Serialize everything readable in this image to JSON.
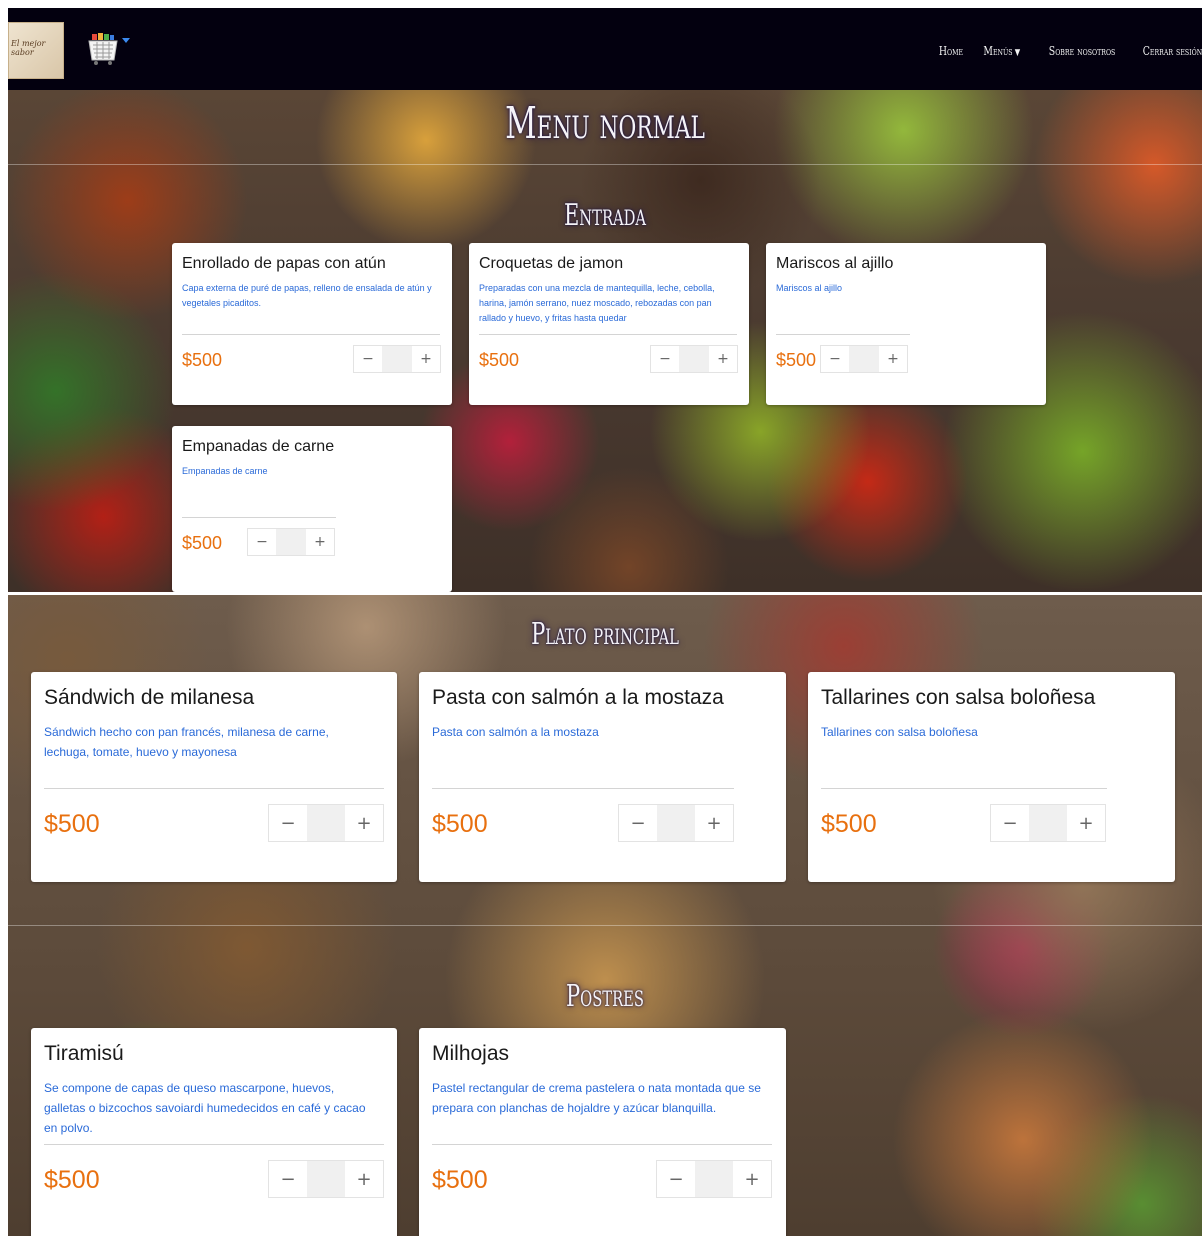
{
  "navbar": {
    "logo_text": "El mejor sabor",
    "links": [
      "Home",
      "Menús",
      "Sobre nosotros",
      "Cerrar sesión"
    ]
  },
  "colors": {
    "navbar": "#03000f",
    "price": "#e8700f",
    "desc": "#2a6ad8"
  },
  "page_title": "Menu normal",
  "sections": [
    {
      "title": "Entrada",
      "items": [
        {
          "name": "Enrollado de papas con atún",
          "desc": "Capa externa de puré de papas, relleno de ensalada de atún y vegetales picaditos.",
          "price": "$500"
        },
        {
          "name": "Croquetas de jamon",
          "desc": "Preparadas con una mezcla de mantequilla, leche, cebolla, harina, jamón serrano, nuez moscado, rebozadas con pan rallado y huevo, y fritas hasta quedar",
          "price": "$500"
        },
        {
          "name": "Mariscos al ajillo",
          "desc": "Mariscos al ajillo",
          "price": "$500"
        },
        {
          "name": "Empanadas de carne",
          "desc": "Empanadas de carne",
          "price": "$500"
        }
      ]
    },
    {
      "title": "Plato principal",
      "items": [
        {
          "name": "Sándwich de milanesa",
          "desc": "Sándwich hecho con pan francés, milanesa de carne, lechuga, tomate, huevo y mayonesa",
          "price": "$500"
        },
        {
          "name": "Pasta con salmón a la mostaza",
          "desc": "Pasta con salmón a la mostaza",
          "price": "$500"
        },
        {
          "name": "Tallarines con salsa boloñesa",
          "desc": "Tallarines con salsa boloñesa",
          "price": "$500"
        }
      ]
    },
    {
      "title": "Postres",
      "items": [
        {
          "name": "Tiramisú",
          "desc": "Se compone de capas de queso mascarpone, huevos, galletas o bizcochos savoiardi humedecidos en café y cacao en polvo.",
          "price": "$500"
        },
        {
          "name": "Milhojas",
          "desc": "Pastel rectangular de crema pastelera o nata montada que se prepara con planchas de hojaldre y azúcar blanquilla.",
          "price": "$500"
        }
      ]
    }
  ],
  "stepper": {
    "minus": "−",
    "plus": "+"
  }
}
